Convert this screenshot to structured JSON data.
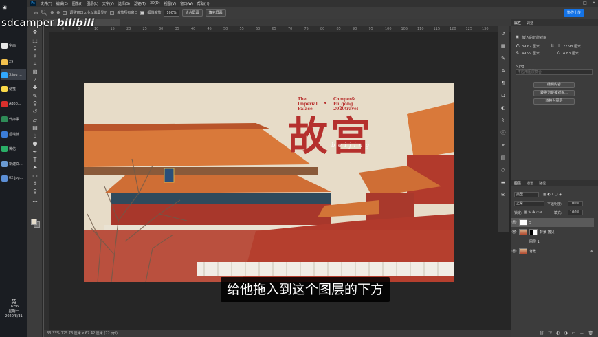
{
  "watermark": {
    "name": "sdcamper",
    "site": "bilibili"
  },
  "taskbar": {
    "items": [
      {
        "label": "字由",
        "color": "#e6e6e6"
      },
      {
        "label": "29",
        "color": "#f2c14e"
      },
      {
        "label": "3.jpg ...",
        "color": "#31a8ff"
      },
      {
        "label": "便笺",
        "color": "#f9d949"
      },
      {
        "label": "Adob...",
        "color": "#d9302c"
      },
      {
        "label": "代办事...",
        "color": "#2e8b57"
      },
      {
        "label": "后端使...",
        "color": "#3b7dd8"
      },
      {
        "label": "微信",
        "color": "#2aae67"
      },
      {
        "label": "新建文...",
        "color": "#6b9bd2"
      },
      {
        "label": "02.jpg...",
        "color": "#5c8fd6"
      }
    ],
    "ime": "英",
    "time": "16:56",
    "weekday": "星期一",
    "date": "2020/8/31"
  },
  "menubar": {
    "logo": "Ps",
    "items": [
      "文件(F)",
      "编辑(E)",
      "图像(I)",
      "图层(L)",
      "文字(Y)",
      "选择(S)",
      "滤镜(T)",
      "3D(D)",
      "视图(V)",
      "窗口(W)",
      "帮助(H)"
    ]
  },
  "options": {
    "resize_windows": "调整窗口大小以满屏显示",
    "zoom_all": "缩放所有窗口",
    "scrubby_zoom": "细微缩放",
    "zoom_value": "100%",
    "fit_screen": "适合屏幕",
    "fill_screen": "填充屏幕",
    "share": "协作上传"
  },
  "document": {
    "status": "33.33%    125.73 厘米 x 67.42 厘米 (72 ppi)"
  },
  "ruler_ticks": [
    "0",
    "5",
    "10",
    "15",
    "20",
    "25",
    "30",
    "35",
    "40",
    "45",
    "50",
    "55",
    "60",
    "65",
    "70",
    "75",
    "80",
    "85",
    "90",
    "95",
    "100",
    "105",
    "110",
    "115",
    "120",
    "125",
    "130",
    "135"
  ],
  "artwork": {
    "left_lines": [
      "The",
      "Imperial",
      "Palace"
    ],
    "right_lines": [
      "Camper&",
      "Fu_gong",
      "2020travel"
    ],
    "title": "故宫",
    "subtitle": "beijing"
  },
  "subtitle_caption": "给他拖入到这个图层的下方",
  "properties": {
    "tabs": [
      "属性",
      "调整"
    ],
    "layer_type": "嵌入的智能对象",
    "w_label": "W:",
    "w_value": "39.62 厘米",
    "h_label": "H:",
    "h_value": "22.98 厘米",
    "x_label": "X:",
    "x_value": "49.99 厘米",
    "y_label": "Y:",
    "y_value": "4.83 厘米",
    "filename": "5.jpg",
    "comp_placeholder": "不应用图层复合",
    "btn_edit": "编辑内容",
    "btn_convert_linked": "转换为链接对象...",
    "btn_convert_layer": "转换为图层"
  },
  "layers": {
    "tabs": [
      "图层",
      "通道",
      "路径"
    ],
    "filter": "类型",
    "blend_mode": "正常",
    "opacity_label": "不透明度:",
    "opacity_value": "100%",
    "lock_label": "锁定:",
    "fill_label": "填充:",
    "fill_value": "100%",
    "rows": [
      {
        "name": "5",
        "thumb": "white",
        "selected": true
      },
      {
        "name": "背景 拷贝",
        "thumb": "mask",
        "selected": false
      },
      {
        "name": "图层 1",
        "thumb": "none",
        "selected": false
      },
      {
        "name": "背景",
        "thumb": "photo",
        "selected": false
      }
    ],
    "footer_icons": [
      "link-icon",
      "fx-icon",
      "mask-icon",
      "adjust-icon",
      "folder-icon",
      "new-layer-icon",
      "trash-icon"
    ]
  },
  "colors": {
    "accent": "#31a8ff",
    "share_button": "#1473e6",
    "art_red": "#b5302d",
    "wall_red": "#b23a2c",
    "roof_orange": "#d9793a"
  }
}
